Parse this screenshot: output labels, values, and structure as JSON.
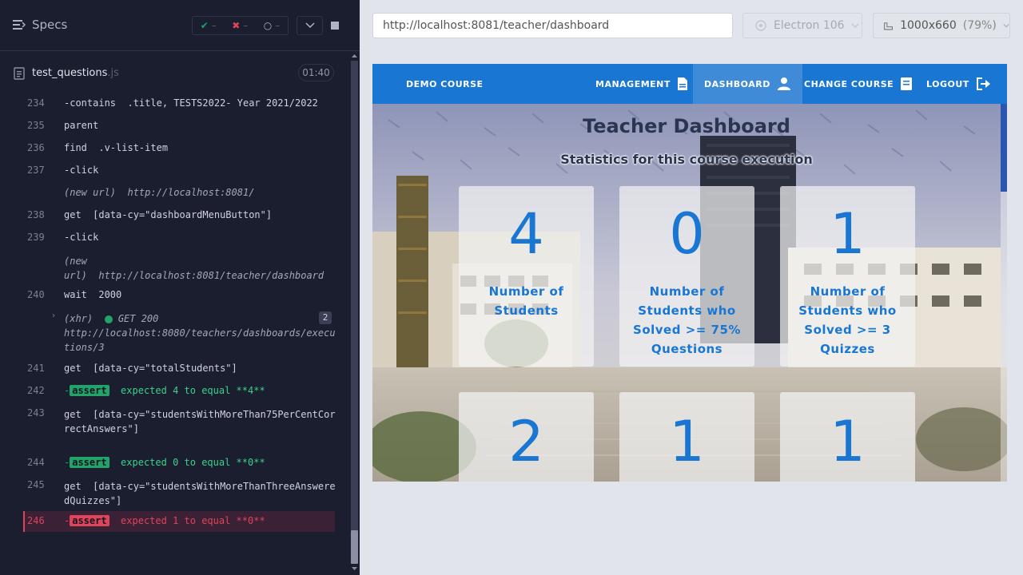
{
  "reporter": {
    "specs_label": "Specs",
    "passed": "–",
    "failed": "–",
    "pending": "–",
    "spec_file": "test_questions",
    "spec_ext": ".js",
    "duration": "01:40"
  },
  "commands": [
    {
      "num": "234",
      "name": "-contains",
      "msg": ".title, TESTS2022- Year 2021/2022"
    },
    {
      "num": "235",
      "name": "parent",
      "msg": ""
    },
    {
      "num": "236",
      "name": "find",
      "msg": ".v-list-item"
    },
    {
      "num": "237",
      "name": "-click",
      "msg": ""
    },
    {
      "num": "",
      "name": "(new url)",
      "msg": "http://localhost:8081/"
    },
    {
      "num": "238",
      "name": "get",
      "msg": "[data-cy=\"dashboardMenuButton\"]"
    },
    {
      "num": "239",
      "name": "-click",
      "msg": ""
    },
    {
      "num": "",
      "name": "(new url)",
      "msg": "http://localhost:8081/teacher/dashboard"
    },
    {
      "num": "240",
      "name": "wait",
      "msg": "2000"
    },
    {
      "num": "",
      "name": "(xhr)",
      "msg": "GET 200",
      "url": "http://localhost:8080/teachers/dashboards/executions/3",
      "count": "2"
    },
    {
      "num": "241",
      "name": "get",
      "msg": "[data-cy=\"totalStudents\"]"
    },
    {
      "num": "242",
      "name": "assert",
      "msg": "expected 4 to equal **4**"
    },
    {
      "num": "243",
      "name": "get",
      "msg": "[data-cy=\"studentsWithMoreThan75PerCentCorrectAnswers\"]"
    },
    {
      "num": "244",
      "name": "assert",
      "msg": "expected 0 to equal **0**"
    },
    {
      "num": "245",
      "name": "get",
      "msg": "[data-cy=\"studentsWithMoreThanThreeAnsweredQuizzes\"]"
    },
    {
      "num": "246",
      "name": "assert",
      "msg": "expected 1 to equal **0**"
    }
  ],
  "aut": {
    "url": "http://localhost:8081/teacher/dashboard",
    "browser": "Electron 106",
    "viewport": "1000x660",
    "scale": "(79%)"
  },
  "app": {
    "nav": {
      "brand": "DEMO COURSE",
      "management": "MANAGEMENT",
      "dashboard": "DASHBOARD",
      "change_course": "CHANGE COURSE",
      "logout": "LOGOUT"
    },
    "title": "Teacher Dashboard",
    "subtitle": "Statistics for this course execution",
    "cards": [
      {
        "value": "4",
        "label": "Number of Students"
      },
      {
        "value": "0",
        "label": "Number of Students who Solved >= 75% Questions"
      },
      {
        "value": "1",
        "label": "Number of Students who Solved >= 3 Quizzes"
      },
      {
        "value": "2",
        "label": ""
      },
      {
        "value": "1",
        "label": ""
      },
      {
        "value": "1",
        "label": ""
      }
    ]
  },
  "colors": {
    "primary": "#1976d2",
    "pass": "#21a36a",
    "fail": "#e0445a"
  }
}
